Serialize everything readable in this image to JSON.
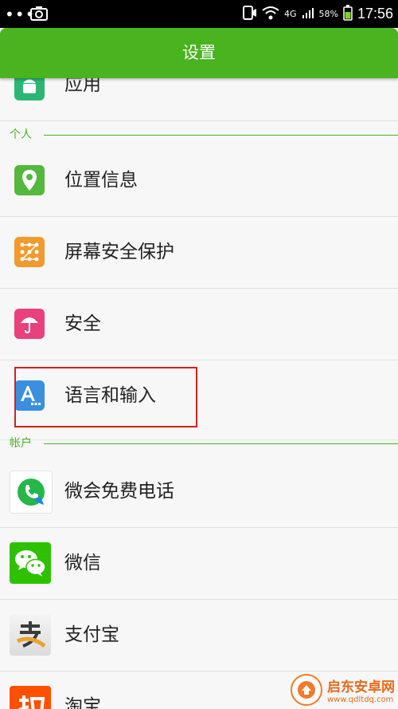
{
  "status_bar": {
    "dots": "•••",
    "network": "4G",
    "battery": "58%",
    "time": "17:56"
  },
  "app_bar": {
    "title": "设置"
  },
  "sections": {
    "personal": "个人",
    "accounts": "帐户"
  },
  "items": [
    {
      "label": "应用",
      "icon": "android-icon",
      "color": "#2bb673"
    },
    {
      "label": "位置信息",
      "icon": "location-pin-icon",
      "color": "#53b83b"
    },
    {
      "label": "屏幕安全保护",
      "icon": "pattern-lock-icon",
      "color": "#f19a2f"
    },
    {
      "label": "安全",
      "icon": "umbrella-icon",
      "color": "#e8417d"
    },
    {
      "label": "语言和输入",
      "icon": "language-a-icon",
      "color": "#3a8fde"
    },
    {
      "label": "微会免费电话",
      "icon": "weihui-phone-icon",
      "color": "#26b64a"
    },
    {
      "label": "微信",
      "icon": "wechat-icon",
      "color": "#2dc100"
    },
    {
      "label": "支付宝",
      "icon": "alipay-icon",
      "color": "#e8a52a"
    },
    {
      "label": "淘宝",
      "icon": "taobao-icon",
      "color": "#ff5000"
    }
  ],
  "watermark": {
    "name": "启东安卓网",
    "url": "www.qdltdq.com"
  },
  "colors": {
    "accent": "#4ab320",
    "highlight": "#d22020"
  }
}
